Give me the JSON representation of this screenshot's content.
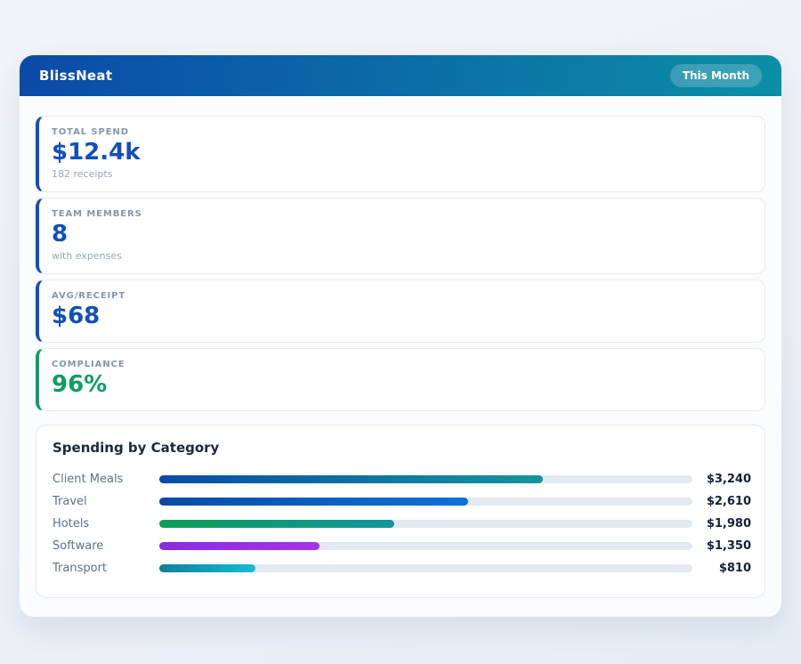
{
  "theme": {
    "header_gradient_left": "#0b4aa8",
    "header_gradient_right": "#0c8ea6",
    "badge_bg": "rgba(255,255,255,0.20)",
    "accent_blue": "#1250b8",
    "accent_green": "#0f9d63",
    "track_color": "#e3e9f1"
  },
  "header": {
    "title": "BlissNeat",
    "period_badge": "This Month"
  },
  "stats": [
    {
      "label": "TOTAL SPEND",
      "value": "$12.4k",
      "sub": "182 receipts",
      "accent": "#1250b8",
      "value_color": "#1250b8"
    },
    {
      "label": "TEAM MEMBERS",
      "value": "8",
      "sub": "with expenses",
      "accent": "#1250b8",
      "value_color": "#1250b8"
    },
    {
      "label": "AVG/RECEIPT",
      "value": "$68",
      "sub": "",
      "accent": "#1250b8",
      "value_color": "#1250b8"
    },
    {
      "label": "COMPLIANCE",
      "value": "96%",
      "sub": "",
      "accent": "#0f9d63",
      "value_color": "#0f9d63"
    }
  ],
  "chart_data": {
    "type": "bar",
    "orientation": "horizontal",
    "title": "Spending by Category",
    "categories": [
      "Client Meals",
      "Travel",
      "Hotels",
      "Software",
      "Transport"
    ],
    "values": [
      3240,
      2610,
      1980,
      1350,
      810
    ],
    "value_labels": [
      "$3,240",
      "$2,610",
      "$1,980",
      "$1,350",
      "$810"
    ],
    "xlim": [
      0,
      4500
    ],
    "bar_pct": [
      72,
      58,
      44,
      30,
      18
    ],
    "bar_gradients": [
      [
        "#0b4aa8",
        "#12969c"
      ],
      [
        "#0a4aa6",
        "#0d72d8"
      ],
      [
        "#0d9e58",
        "#12949c"
      ],
      [
        "#8a2cdc",
        "#a833e8"
      ],
      [
        "#0d819e",
        "#14bcd6"
      ]
    ],
    "track_color": "#e3e9f1",
    "grid": false,
    "legend": false
  }
}
